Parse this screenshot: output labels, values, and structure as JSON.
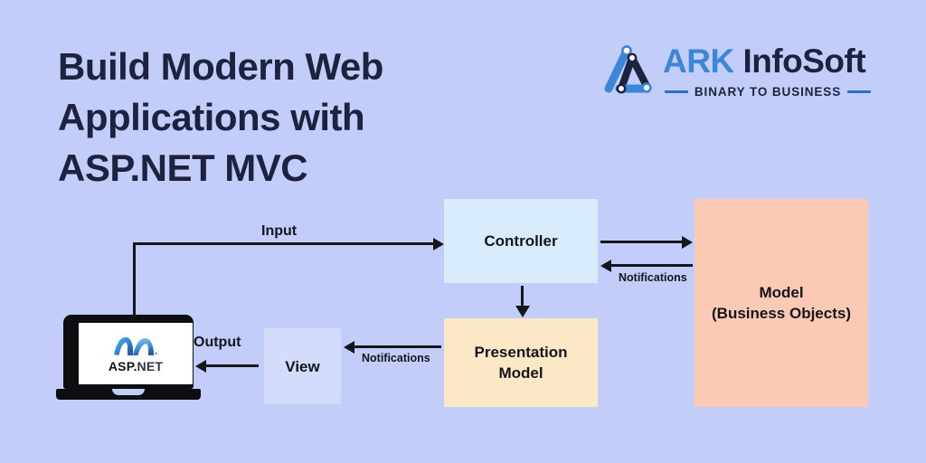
{
  "background_color": "#c3cdfa",
  "headline": {
    "lines": [
      "Build Modern Web",
      "Applications with",
      "ASP.NET MVC"
    ],
    "color": "#1d233f"
  },
  "logo": {
    "mark_name": "ark-triangle-mark",
    "brand_primary": "ARK",
    "brand_secondary": "InfoSoft",
    "tagline": "BINARY TO BUSINESS",
    "primary_color": "#3a86d8",
    "secondary_color": "#1d233f"
  },
  "diagram": {
    "boxes": [
      {
        "id": "controller",
        "label": "Controller",
        "color": "#d9ecfb"
      },
      {
        "id": "model",
        "label": "Model\n(Business Objects)",
        "color": "#fbc9b4",
        "label_line1": "Model",
        "label_line2": "(Business Objects)"
      },
      {
        "id": "presentation",
        "label": "Presentation Model",
        "color": "#fce7c6",
        "label_line1": "Presentation",
        "label_line2": "Model"
      },
      {
        "id": "view",
        "label": "View",
        "color": "#d3dcfa"
      }
    ],
    "device": {
      "name": "laptop",
      "screen_logo": "aspnet-logo",
      "screen_text_primary": "ASP.",
      "screen_text_secondary": "NET"
    },
    "arrows": [
      {
        "id": "input",
        "label": "Input",
        "from": "laptop",
        "to": "controller",
        "direction": "right"
      },
      {
        "id": "controller-to-model",
        "label": "",
        "from": "controller",
        "to": "model",
        "direction": "right"
      },
      {
        "id": "model-to-controller",
        "label": "Notifications",
        "from": "model",
        "to": "controller",
        "direction": "left"
      },
      {
        "id": "controller-to-presentation",
        "label": "",
        "from": "controller",
        "to": "presentation",
        "direction": "down"
      },
      {
        "id": "presentation-to-view",
        "label": "Notifications",
        "from": "presentation",
        "to": "view",
        "direction": "left"
      },
      {
        "id": "output",
        "label": "Output",
        "from": "view",
        "to": "laptop",
        "direction": "left"
      }
    ]
  }
}
